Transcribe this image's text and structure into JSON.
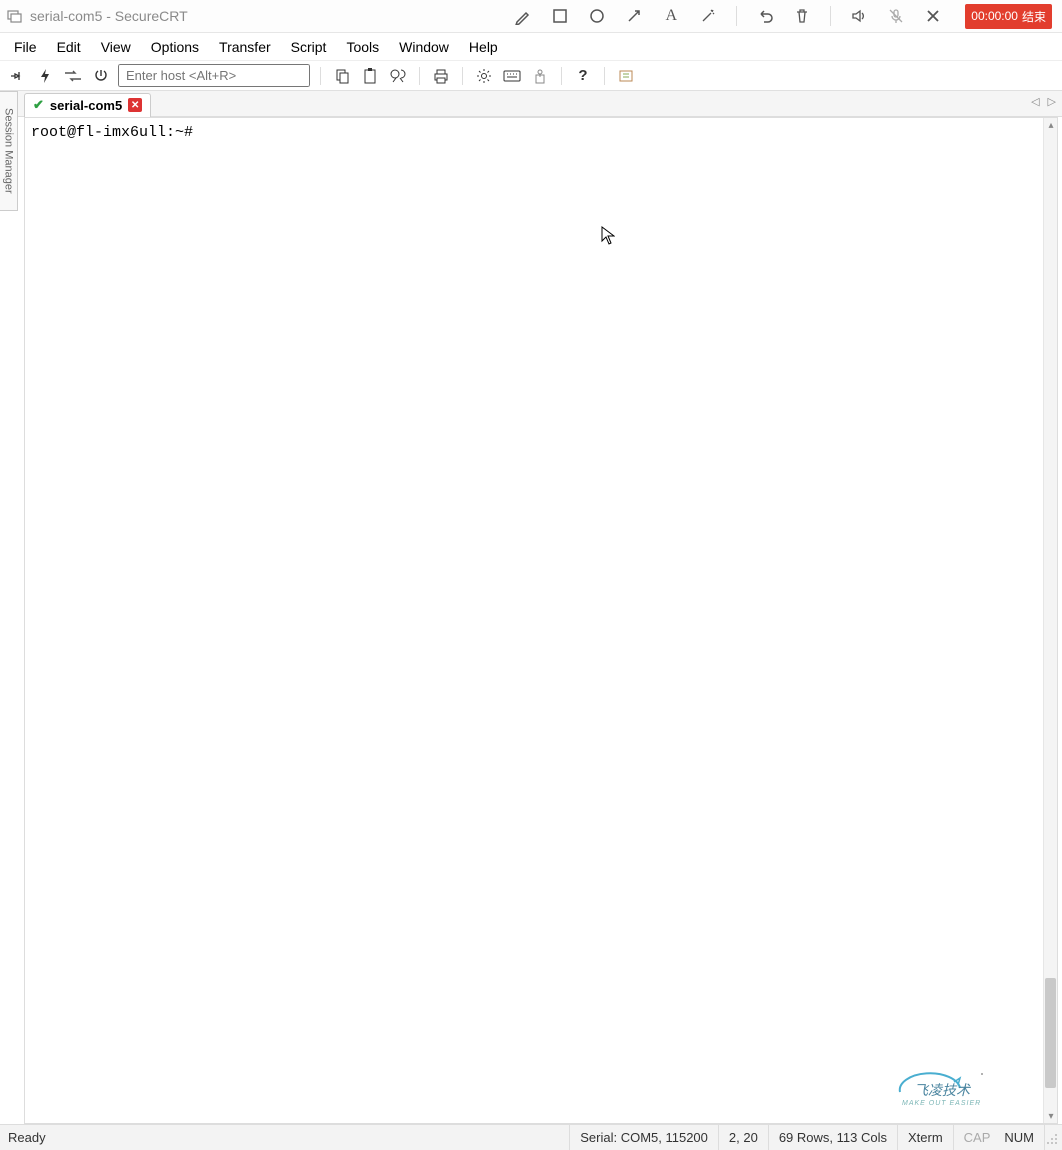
{
  "titlebar": {
    "title": "serial-com5 - SecureCRT"
  },
  "overlay": {
    "icons": {
      "pencil": "pencil",
      "square": "square",
      "circle": "circle",
      "arrow": "arrow",
      "text": "text",
      "wand": "wand",
      "undo": "undo",
      "trash": "trash",
      "speaker": "speaker",
      "mic": "mic-mute",
      "close": "close"
    },
    "record_time": "00:00:00",
    "record_label": "结束"
  },
  "menu": {
    "items": [
      "File",
      "Edit",
      "View",
      "Options",
      "Transfer",
      "Script",
      "Tools",
      "Window",
      "Help"
    ]
  },
  "toolbar": {
    "host_placeholder": "Enter host <Alt+R>",
    "icons": {
      "connect": "connect",
      "quick": "quick-connect",
      "reconnect": "reconnect",
      "disconnect": "disconnect",
      "copy": "copy",
      "paste": "paste",
      "find": "find",
      "print": "print",
      "settings": "settings",
      "keys": "keys",
      "keymap": "keymap",
      "help": "help",
      "lang": "lang"
    }
  },
  "tabs": {
    "items": [
      {
        "name": "serial-com5",
        "connected": true
      }
    ]
  },
  "session_manager_label": "Session Manager",
  "terminal": {
    "prompt": "root@fl-imx6ull:~#"
  },
  "status": {
    "ready": "Ready",
    "conn": "Serial: COM5, 115200",
    "pos": "2,  20",
    "size": "69 Rows, 113 Cols",
    "term": "Xterm",
    "cap": "CAP",
    "num": "NUM"
  },
  "watermark": {
    "line1": "飞凌技术",
    "line2": "MAKE OUT EASIER"
  }
}
